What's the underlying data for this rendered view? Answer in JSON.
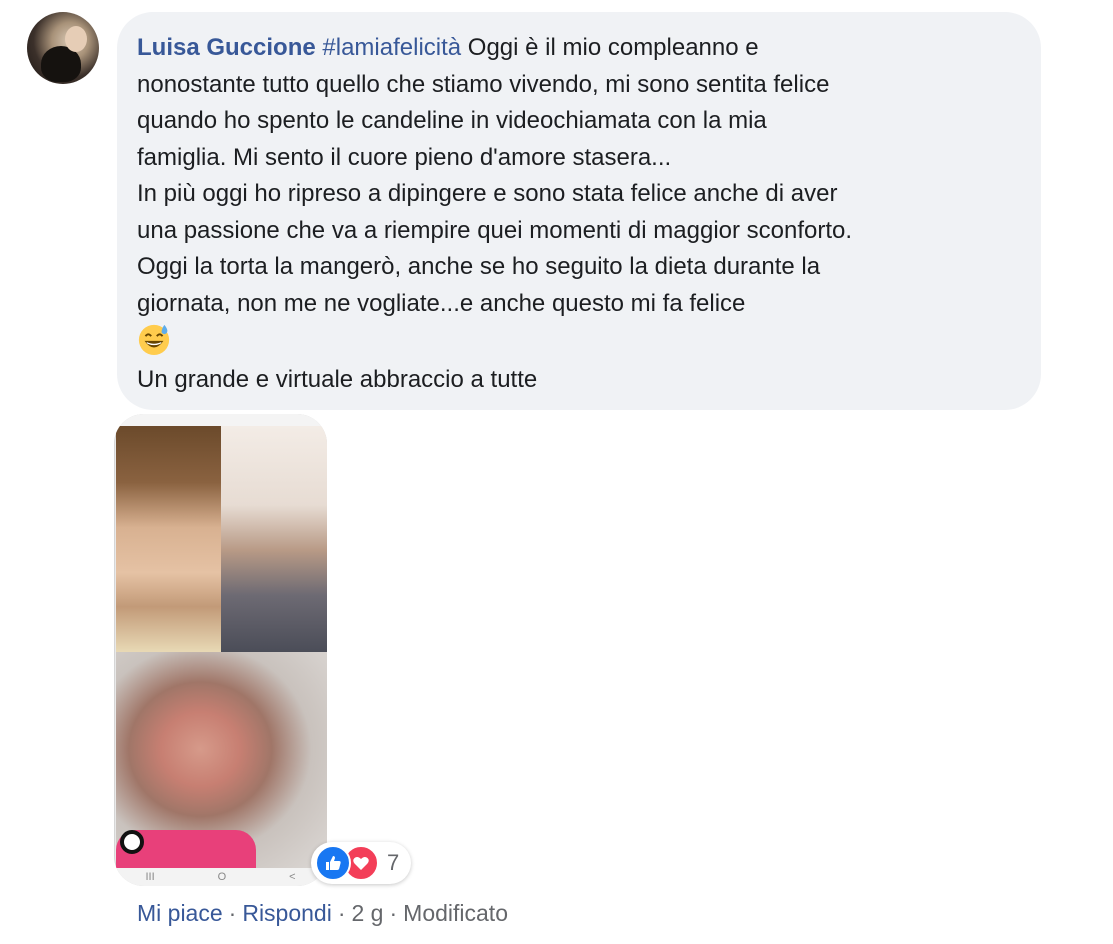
{
  "comment": {
    "author": "Luisa Guccione",
    "hashtag": "#lamiafelicità",
    "first_line_text": " Oggi è il mio compleanno e",
    "lines": [
      "nonostante tutto quello che stiamo vivendo, mi sono sentita felice",
      "quando ho spento le candeline in videochiamata con la mia",
      "famiglia. Mi sento il cuore pieno d'amore stasera...",
      "In più oggi ho ripreso a dipingere e sono stata felice anche di aver",
      "una passione che va a riempire quei momenti di maggior sconforto.",
      "Oggi la torta la mangerò, anche se ho seguito la dieta durante la",
      "giornata, non me ne vogliate...e anche questo mi fa felice"
    ],
    "emoji": "grinning-sweat-face",
    "last_line": "Un grande e virtuale abbraccio a tutte"
  },
  "photo": {
    "navbar": [
      "III",
      "O",
      "<"
    ]
  },
  "reactions": {
    "types": [
      "like",
      "love"
    ],
    "count": "7",
    "colors": {
      "like": "#1877f2",
      "love": "#f33e58"
    }
  },
  "actions": {
    "like": "Mi piace",
    "reply": "Rispondi",
    "time": "2 g",
    "edited": "Modificato",
    "separator": "·"
  },
  "colors": {
    "link": "#385898",
    "bubble_bg": "#f0f2f5",
    "text": "#1c1e21",
    "meta": "#65676b"
  }
}
